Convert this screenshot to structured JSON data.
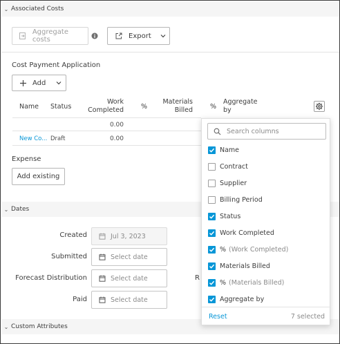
{
  "associated_costs": {
    "section_title": "Associated Costs",
    "aggregate_label": "Aggregate costs",
    "export_label": "Export"
  },
  "cost_payment": {
    "title": "Cost Payment Application",
    "add_label": "Add",
    "columns": [
      "Name",
      "Status",
      "Work Completed",
      "%",
      "Materials Billed",
      "%",
      "Aggregate by"
    ],
    "totals": {
      "work_completed": "0.00"
    },
    "rows": [
      {
        "name": "New Co...",
        "status": "Draft",
        "work_completed": "0.00"
      }
    ]
  },
  "expense": {
    "title": "Expense",
    "add_existing_label": "Add existing"
  },
  "dates": {
    "section_title": "Dates",
    "created_label": "Created",
    "created_value": "Jul 3, 2023",
    "submitted_label": "Submitted",
    "forecast_label": "Forecast Distribution",
    "paid_label": "Paid",
    "placeholder": "Select date",
    "clipped_label": "R"
  },
  "custom_attributes": {
    "section_title": "Custom Attributes"
  },
  "column_picker": {
    "search_placeholder": "Search columns",
    "options": [
      {
        "label": "Name",
        "checked": true
      },
      {
        "label": "Contract",
        "checked": false
      },
      {
        "label": "Supplier",
        "checked": false
      },
      {
        "label": "Billing Period",
        "checked": false
      },
      {
        "label": "Status",
        "checked": true
      },
      {
        "label": "Work Completed",
        "checked": true
      },
      {
        "label": "%",
        "suffix": "(Work Completed)",
        "checked": true
      },
      {
        "label": "Materials Billed",
        "checked": true
      },
      {
        "label": "%",
        "suffix": "(Materials Billed)",
        "checked": true
      },
      {
        "label": "Aggregate by",
        "checked": true
      }
    ],
    "reset_label": "Reset",
    "selected_count": "7 selected"
  },
  "colors": {
    "accent": "#0696d7",
    "section_bg": "#f5f5f5"
  }
}
